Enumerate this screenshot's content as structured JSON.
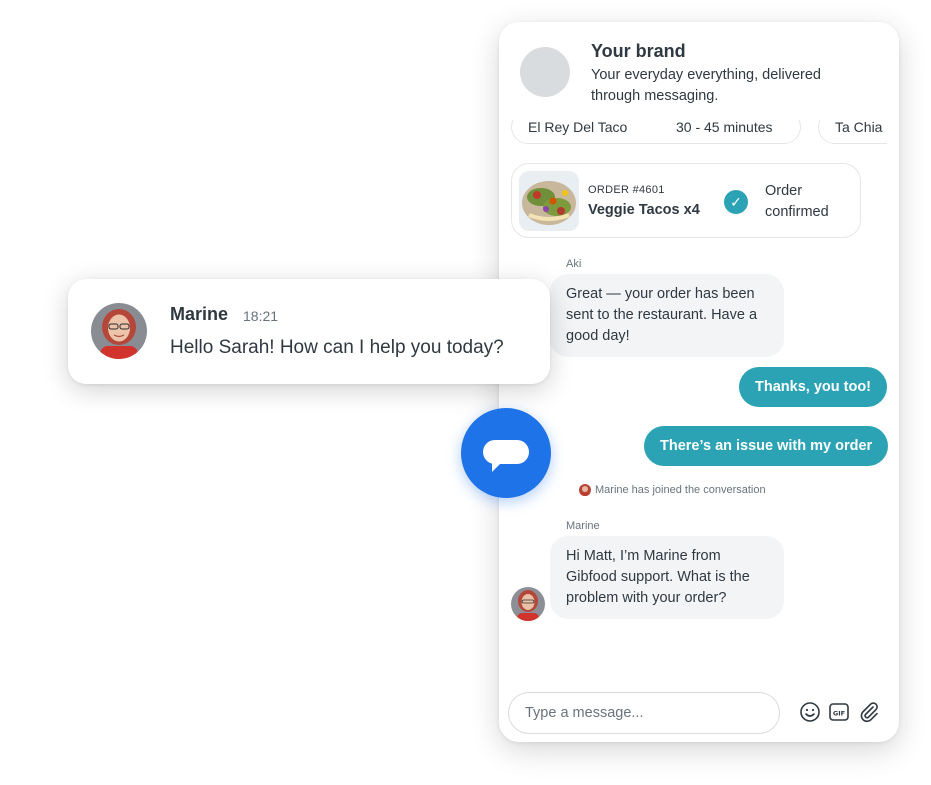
{
  "widget": {
    "brand_name": "Your brand",
    "brand_tagline": "Your everyday everything, delivered through messaging.",
    "carousel": {
      "card1_name": "El Rey Del Taco",
      "card1_time": "30 - 45 minutes",
      "card2_name": "Ta Chia"
    },
    "order": {
      "number": "ORDER #4601",
      "item": "Veggie Tacos x4",
      "status": "Order confirmed"
    },
    "messages": {
      "sender_aki": "Aki",
      "aki_text": "Great — your order has been sent to the restaurant. Have a good day!",
      "user_reply_1": "Thanks, you too!",
      "user_reply_2": "There’s an issue with my order",
      "system_joined": "Marine has joined the conversation",
      "sender_marine": "Marine",
      "marine_text": "Hi Matt, I’m Marine from Gibfood support. What is the problem with your order?"
    },
    "composer": {
      "placeholder": "Type a message..."
    },
    "icons": {
      "emoji": "emoji-icon",
      "gif": "gif-icon",
      "attach": "paperclip-icon"
    },
    "colors": {
      "accent": "#2ba3b4",
      "launcher": "#1f73e8",
      "bubble_in": "#f3f4f6"
    }
  },
  "notification": {
    "name": "Marine",
    "time": "18:21",
    "text": "Hello Sarah! How can I help you today?"
  },
  "launcher": {
    "icon": "chat-bubble-icon"
  }
}
